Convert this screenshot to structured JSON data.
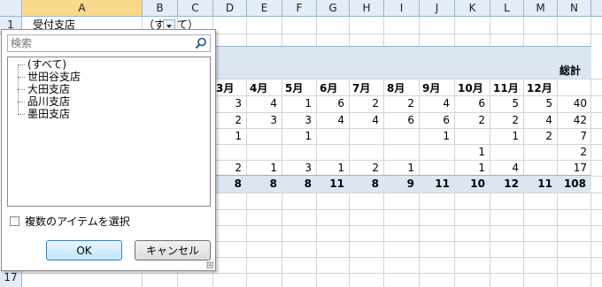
{
  "columns": [
    "A",
    "B",
    "C",
    "D",
    "E",
    "F",
    "G",
    "H",
    "I",
    "J",
    "K",
    "L",
    "M",
    "N"
  ],
  "rows_visible": [
    "1",
    "17"
  ],
  "cell_A1": "受付支店",
  "cell_B1": "（す",
  "cell_C1": "て）",
  "months": [
    "3月",
    "4月",
    "5月",
    "6月",
    "7月",
    "8月",
    "9月",
    "10月",
    "11月",
    "12月"
  ],
  "total_label": "総計",
  "data_rows": [
    [
      "3",
      "4",
      "1",
      "6",
      "2",
      "2",
      "4",
      "6",
      "5",
      "5",
      "40"
    ],
    [
      "2",
      "3",
      "3",
      "4",
      "4",
      "6",
      "6",
      "2",
      "2",
      "4",
      "42"
    ],
    [
      "1",
      "",
      "1",
      "",
      "",
      "",
      "1",
      "",
      "1",
      "2",
      "7"
    ],
    [
      "",
      "",
      "",
      "",
      "",
      "",
      "",
      "1",
      "",
      "",
      "2"
    ],
    [
      "2",
      "1",
      "3",
      "1",
      "2",
      "1",
      "",
      "1",
      "4",
      "",
      "17"
    ]
  ],
  "total_row": [
    "8",
    "8",
    "8",
    "11",
    "8",
    "9",
    "11",
    "10",
    "12",
    "11",
    "108"
  ],
  "filter_popup": {
    "search_placeholder": "検索",
    "items": [
      "(すべて)",
      "世田谷支店",
      "大田支店",
      "品川支店",
      "墨田支店"
    ],
    "multi_select_label": "複数のアイテムを選択",
    "ok_label": "OK",
    "cancel_label": "キャンセル"
  }
}
